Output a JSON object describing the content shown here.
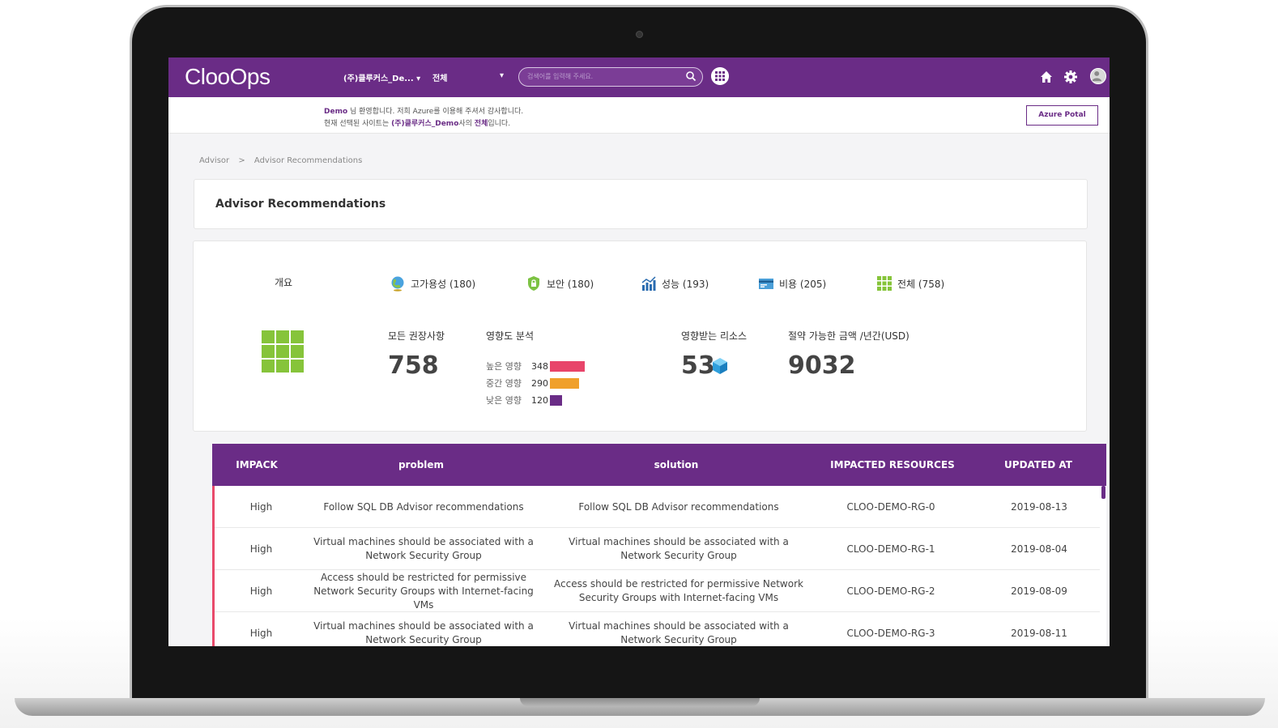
{
  "app": {
    "name": "ClooOps"
  },
  "header": {
    "tenant": "(주)클루커스_De... ▾",
    "scope": "전체",
    "scope_caret": "▾",
    "search_placeholder": "검색어를 입력해 주세요.",
    "icons": [
      "search-icon",
      "apps-grid-icon",
      "home-icon",
      "gear-icon",
      "user-avatar-icon"
    ]
  },
  "welcome": {
    "line1_user": "Demo",
    "line1_text": " 님 환영합니다. 저희 Azure를 이용해 주셔서 감사합니다.",
    "line2_prefix": "현재 선택된 사이트는 ",
    "line2_company": "(주)클루커스_Demo",
    "line2_mid": "사의 ",
    "line2_scope": "전체",
    "line2_suffix": "입니다.",
    "portal_button": "Azure Potal"
  },
  "breadcrumb": [
    "Advisor",
    ">",
    "Advisor Recommendations"
  ],
  "page_title": "Advisor Recommendations",
  "summary": {
    "overview_label": "개요",
    "categories": [
      {
        "label": "고가용성 (180)",
        "icon": "globe-icon"
      },
      {
        "label": "보안 (180)",
        "icon": "shield-lock-icon"
      },
      {
        "label": "성능 (193)",
        "icon": "chart-performance-icon"
      },
      {
        "label": "비용 (205)",
        "icon": "billing-card-icon"
      },
      {
        "label": "전체 (758)",
        "icon": "grid-all-icon"
      }
    ],
    "all_recs_label": "모든 권장사항",
    "all_recs_value": "758",
    "impact_label": "영향도 분석",
    "impact": [
      {
        "label": "높은 영향",
        "value": 348,
        "color": "#e8456a"
      },
      {
        "label": "중간 영향",
        "value": 290,
        "color": "#f0a02b"
      },
      {
        "label": "낮은 영향",
        "value": 120,
        "color": "#6a2c86"
      }
    ],
    "impact_values_text": [
      "348",
      "290",
      "120"
    ],
    "resources_label": "영향받는 리소스",
    "resources_value": "53",
    "savings_label": "절약 가능한 금액 /년간(USD)",
    "savings_value": "9032"
  },
  "table": {
    "headers": [
      "IMPACK",
      "problem",
      "solution",
      "IMPACTED RESOURCES",
      "UPDATED AT"
    ],
    "rows": [
      {
        "impact": "High",
        "problem": "Follow SQL DB Advisor recommendations",
        "solution": "Follow SQL DB Advisor recommendations",
        "resource": "CLOO-DEMO-RG-0",
        "updated": "2019-08-13"
      },
      {
        "impact": "High",
        "problem": "Virtual machines should be associated with a Network Security Group",
        "solution": "Virtual machines should be associated with a Network Security Group",
        "resource": "CLOO-DEMO-RG-1",
        "updated": "2019-08-04"
      },
      {
        "impact": "High",
        "problem": "Access should be restricted for permissive Network Security Groups with Internet-facing VMs",
        "solution": "Access should be restricted for permissive Network Security Groups with Internet-facing VMs",
        "resource": "CLOO-DEMO-RG-2",
        "updated": "2019-08-09"
      },
      {
        "impact": "High",
        "problem": "Virtual machines should be associated with a Network Security Group",
        "solution": "Virtual machines should be associated with a Network Security Group",
        "resource": "CLOO-DEMO-RG-3",
        "updated": "2019-08-11"
      }
    ]
  },
  "colors": {
    "brand": "#6a2c86",
    "high": "#e8456a",
    "medium": "#f0a02b",
    "low": "#6a2c86",
    "grid": "#86c43a"
  }
}
